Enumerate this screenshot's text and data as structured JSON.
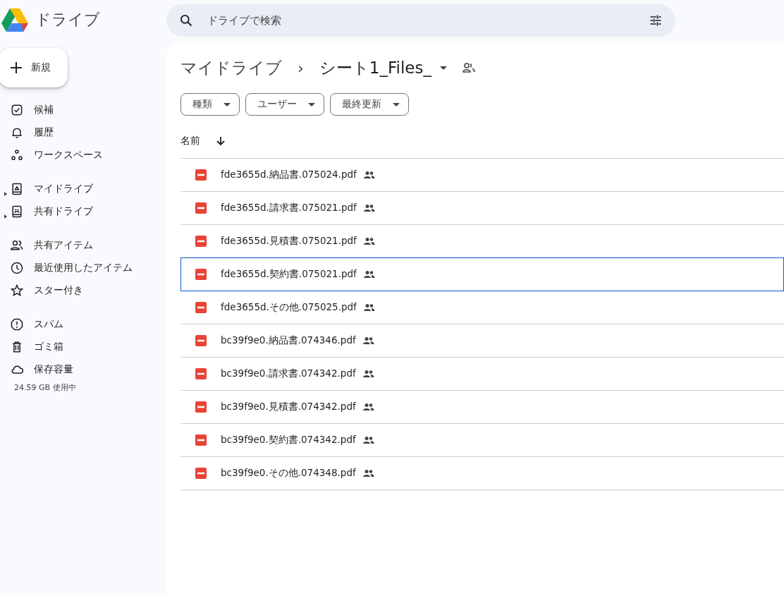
{
  "app": {
    "name": "ドライブ"
  },
  "search": {
    "placeholder": "ドライブで検索"
  },
  "new_button": {
    "label": "新規"
  },
  "sidebar": {
    "groups": [
      [
        {
          "label": "候補",
          "expandable": false
        },
        {
          "label": "履歴",
          "expandable": false
        },
        {
          "label": "ワークスペース",
          "expandable": false
        }
      ],
      [
        {
          "label": "マイドライブ",
          "expandable": true
        },
        {
          "label": "共有ドライブ",
          "expandable": true
        }
      ],
      [
        {
          "label": "共有アイテム",
          "expandable": false
        },
        {
          "label": "最近使用したアイテム",
          "expandable": false
        },
        {
          "label": "スター付き",
          "expandable": false
        }
      ],
      [
        {
          "label": "スパム",
          "expandable": false
        },
        {
          "label": "ゴミ箱",
          "expandable": false
        },
        {
          "label": "保存容量",
          "expandable": false
        }
      ]
    ],
    "storage": "24.59 GB 使用中"
  },
  "breadcrumb": {
    "parent": "マイドライブ",
    "separator": "›",
    "current": "シート1_Files_",
    "shared": true
  },
  "filters": [
    "種類",
    "ユーザー",
    "最終更新"
  ],
  "table": {
    "columns": [
      {
        "label": "名前"
      }
    ],
    "rows": [
      {
        "name": "fde3655d.納品書.075024.pdf",
        "shared": true,
        "selected": false
      },
      {
        "name": "fde3655d.請求書.075021.pdf",
        "shared": true,
        "selected": false
      },
      {
        "name": "fde3655d.見積書.075021.pdf",
        "shared": true,
        "selected": false
      },
      {
        "name": "fde3655d.契約書.075021.pdf",
        "shared": true,
        "selected": true
      },
      {
        "name": "fde3655d.その他.075025.pdf",
        "shared": true,
        "selected": false
      },
      {
        "name": "bc39f9e0.納品書.074346.pdf",
        "shared": true,
        "selected": false
      },
      {
        "name": "bc39f9e0.請求書.074342.pdf",
        "shared": true,
        "selected": false
      },
      {
        "name": "bc39f9e0.見積書.074342.pdf",
        "shared": true,
        "selected": false
      },
      {
        "name": "bc39f9e0.契約書.074342.pdf",
        "shared": true,
        "selected": false
      },
      {
        "name": "bc39f9e0.その他.074348.pdf",
        "shared": true,
        "selected": false
      }
    ]
  }
}
